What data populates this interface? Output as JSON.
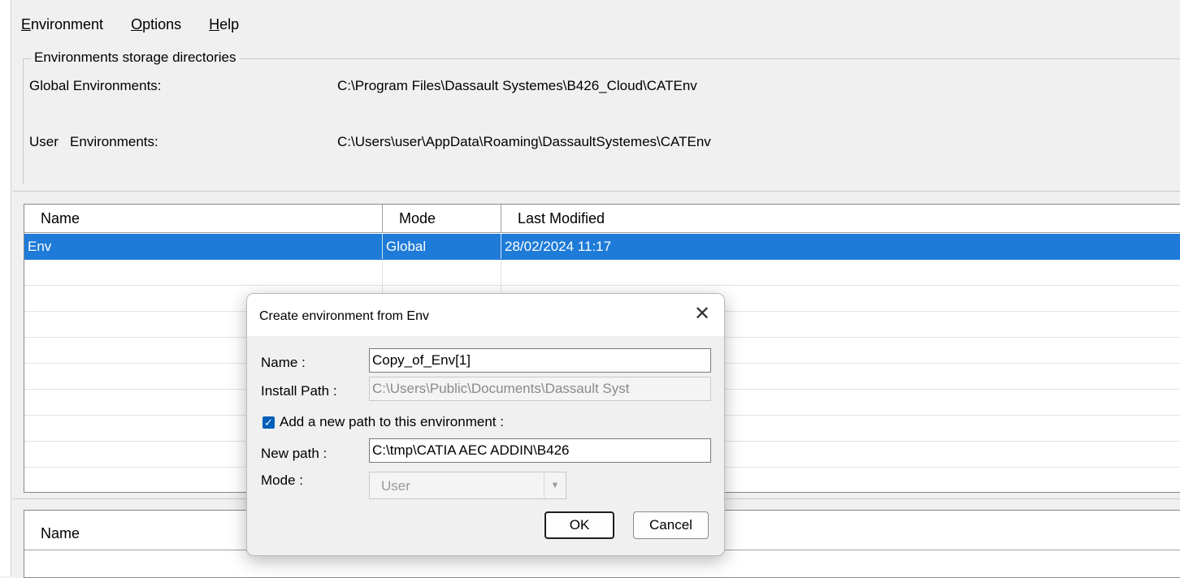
{
  "menu": [
    {
      "accel": "E",
      "rest": "nvironment"
    },
    {
      "accel": "O",
      "rest": "ptions"
    },
    {
      "accel": "H",
      "rest": "elp"
    }
  ],
  "storage": {
    "title": "Environments storage directories",
    "global_label": "Global Environments:",
    "global_path": "C:\\Program Files\\Dassault Systemes\\B426_Cloud\\CATEnv",
    "user_label": "User   Environments:",
    "user_path": "C:\\Users\\user\\AppData\\Roaming\\DassaultSystemes\\CATEnv"
  },
  "env_list": {
    "columns": [
      "Name",
      "Mode",
      "Last Modified"
    ],
    "rows": [
      {
        "name": "Env",
        "mode": "Global",
        "modified": "28/02/2024  11:17",
        "selected": true
      }
    ]
  },
  "path_list": {
    "columns": [
      "Name"
    ]
  },
  "dialog": {
    "title": "Create environment from Env",
    "close_glyph": "✕",
    "name_label": "Name :",
    "name_value": "Copy_of_Env[1]",
    "install_label": "Install Path :",
    "install_value": "C:\\Users\\Public\\Documents\\Dassault Syst",
    "checkbox_label": "Add a new path to this environment :",
    "checkbox_checked": true,
    "newpath_label": "New path :",
    "newpath_value": "C:\\tmp\\CATIA AEC ADDIN\\B426",
    "mode_label": "Mode :",
    "mode_value": "User",
    "ok_label": "OK",
    "cancel_label": "Cancel"
  },
  "colors": {
    "selection": "#1e7bd8",
    "checkbox": "#005fb8"
  }
}
